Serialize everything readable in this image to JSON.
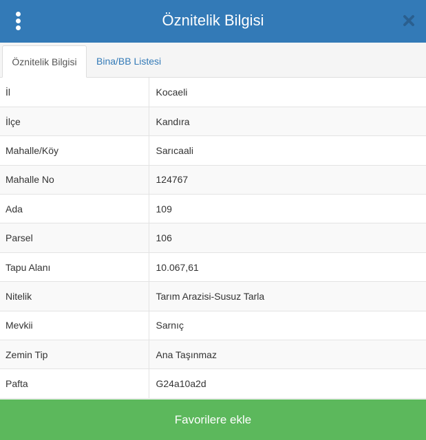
{
  "header": {
    "title": "Öznitelik Bilgisi",
    "menu_icon": "kebab-vertical-icon",
    "close_icon": "close-x-icon",
    "color": "#337ab7"
  },
  "tabs": [
    {
      "label": "Öznitelik Bilgisi",
      "active": true
    },
    {
      "label": "Bina/BB Listesi",
      "active": false
    }
  ],
  "attributes": [
    {
      "key": "İl",
      "value": "Kocaeli"
    },
    {
      "key": "İlçe",
      "value": "Kandıra"
    },
    {
      "key": "Mahalle/Köy",
      "value": "Sarıcaali"
    },
    {
      "key": "Mahalle No",
      "value": "124767"
    },
    {
      "key": "Ada",
      "value": "109"
    },
    {
      "key": "Parsel",
      "value": "106"
    },
    {
      "key": "Tapu Alanı",
      "value": "10.067,61"
    },
    {
      "key": "Nitelik",
      "value": "Tarım Arazisi-Susuz Tarla"
    },
    {
      "key": "Mevkii",
      "value": "Sarnıç"
    },
    {
      "key": "Zemin Tip",
      "value": "Ana Taşınmaz"
    },
    {
      "key": "Pafta",
      "value": "G24a10a2d"
    }
  ],
  "footer": {
    "button_label": "Favorilere ekle",
    "color": "#5cb85c"
  }
}
